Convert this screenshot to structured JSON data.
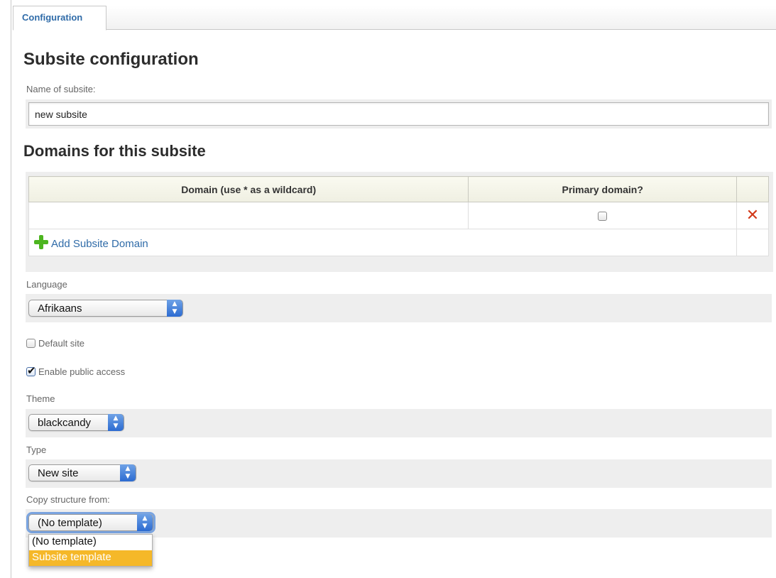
{
  "tabs": [
    {
      "label": "Configuration"
    }
  ],
  "page": {
    "title": "Subsite configuration",
    "name_label": "Name of subsite:",
    "name_value": "new subsite"
  },
  "domains": {
    "heading": "Domains for this subsite",
    "columns": [
      "Domain (use * as a wildcard)",
      "Primary domain?",
      ""
    ],
    "rows": [
      {
        "domain": "",
        "primary": false
      }
    ],
    "add_label": "Add Subsite Domain"
  },
  "language": {
    "label": "Language",
    "value": "Afrikaans"
  },
  "default_site": {
    "label": "Default site",
    "checked": false
  },
  "public_access": {
    "label": "Enable public access",
    "checked": true
  },
  "theme": {
    "label": "Theme",
    "value": "blackcandy"
  },
  "type": {
    "label": "Type",
    "value": "New site"
  },
  "copy_structure": {
    "label": "Copy structure from:",
    "value": "(No template)",
    "options": [
      "(No template)",
      "Subsite template"
    ],
    "highlighted": "Subsite template"
  },
  "colors": {
    "link": "#2f6ba8",
    "delete": "#d23a1a",
    "add": "#4cb51f",
    "highlight": "#f5b829"
  },
  "icons": {
    "delete": "close-x-icon",
    "add": "plus-icon",
    "select": "updown-arrows-icon"
  }
}
